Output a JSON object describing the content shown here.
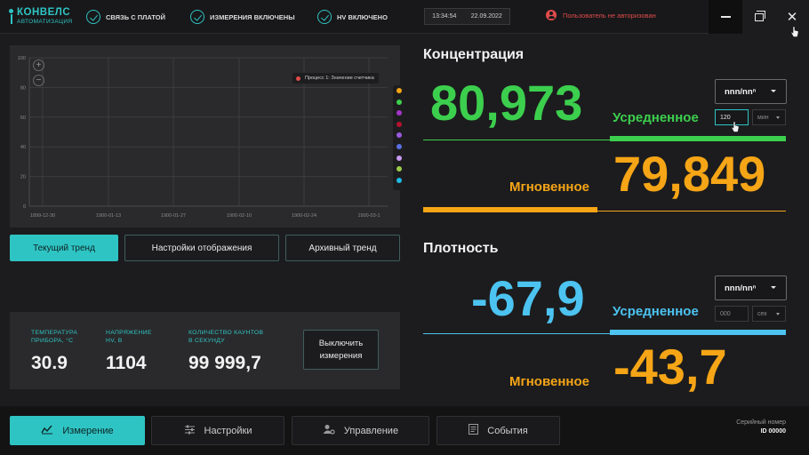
{
  "app": {
    "logo_name": "КОНВЕЛС",
    "logo_sub": "АВТОМАТИЗАЦИЯ",
    "status": [
      {
        "label": "СВЯЗЬ С ПЛАТОЙ"
      },
      {
        "label": "ИЗМЕРЕНИЯ ВКЛЮЧЕНЫ"
      },
      {
        "label": "HV ВКЛЮЧЕНО"
      }
    ],
    "time": "13:34:54",
    "date": "22.09.2022",
    "user_status": "Пользователь не авторизован",
    "accent_color": "#2fc4c4",
    "warning_color": "#e04b4b"
  },
  "chart": {
    "legend_label": "Процесс 1: Значение счетчика",
    "zoom_in": "+",
    "zoom_out": "−",
    "series_colors": [
      "#f5a516",
      "#3ccf4e",
      "#a236c9",
      "#b3122e",
      "#9b59e0",
      "#5b6ee1",
      "#c79bf2",
      "#9ccc4b",
      "#1ebbe6"
    ]
  },
  "chart_data": {
    "type": "line",
    "title": "",
    "xlabel": "",
    "ylabel": "",
    "x_ticks": [
      "1899-12-30",
      "1900-01-13",
      "1900-01-27",
      "1900-02-10",
      "1900-02-24",
      "1900-03-1"
    ],
    "y_ticks": [
      "0",
      "20",
      "40",
      "60",
      "80",
      "100"
    ],
    "ylim": [
      0,
      100
    ],
    "grid": true,
    "legend_position": "top-right",
    "series": [
      {
        "name": "Процесс 1: Значение счетчика",
        "values": []
      }
    ]
  },
  "tabs": {
    "current": "Текущий тренд",
    "display": "Настройки отображения",
    "archive": "Архивный тренд"
  },
  "info": {
    "temp_label_1": "ТЕМПЕРАТУРА",
    "temp_label_2": "ПРИБОРА, °С",
    "temp_value": "30.9",
    "volt_label_1": "НАПРЯЖЕНИЕ",
    "volt_label_2": "HV, В",
    "volt_value": "1104",
    "count_label_1": "КОЛИЧЕСТВО КАУНТОВ",
    "count_label_2": "В СЕКУНДУ",
    "count_value": "99 999,7",
    "off_button_1": "Выключить",
    "off_button_2": "измерения"
  },
  "concentration": {
    "title": "Концентрация",
    "avg_value": "80,973",
    "avg_label": "Усредненное",
    "inst_value": "79,849",
    "inst_label": "Мгновенное",
    "unit": "nnn/nnⁿ",
    "period_value": "120",
    "period_unit": "мин",
    "avg_color": "#3ccf4e",
    "inst_color": "#f5a516"
  },
  "density": {
    "title": "Плотность",
    "avg_value": "-67,9",
    "avg_label": "Усредненное",
    "inst_value": "-43,7",
    "inst_label": "Мгновенное",
    "unit": "nnn/nnⁿ",
    "period_value": "000",
    "period_unit": "сек",
    "avg_color": "#4cc3f0",
    "inst_color": "#f5a516"
  },
  "nav": {
    "measure": "Измерение",
    "settings": "Настройки",
    "control": "Управление",
    "events": "События",
    "serial_label": "Серийный номер",
    "serial_id": "ID 00000"
  }
}
